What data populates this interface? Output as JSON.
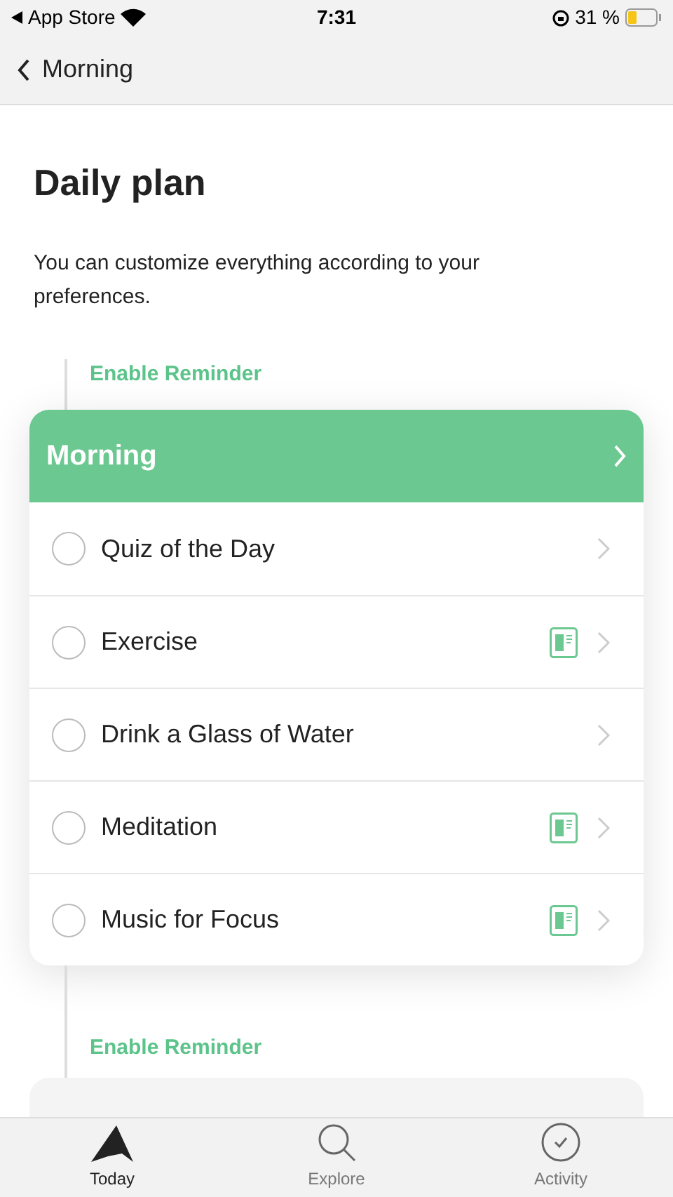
{
  "status_bar": {
    "back_label": "App Store",
    "time": "7:31",
    "battery": "31 %"
  },
  "nav": {
    "back": "Morning"
  },
  "title": "Daily plan",
  "description": "You can customize everything according to your preferences.",
  "sections": [
    {
      "reminder": "Enable Reminder",
      "card": {
        "title": "Morning",
        "items": [
          {
            "label": "Quiz of the Day",
            "checked": false,
            "has_guide": false
          },
          {
            "label": "Exercise",
            "checked": false,
            "has_guide": true
          },
          {
            "label": "Drink a Glass of Water",
            "checked": false,
            "has_guide": false
          },
          {
            "label": "Meditation",
            "checked": false,
            "has_guide": true
          },
          {
            "label": "Music for Focus",
            "checked": false,
            "has_guide": true
          }
        ]
      }
    },
    {
      "reminder": "Enable Reminder"
    }
  ],
  "tab_bar": [
    {
      "label": "Today",
      "kind": "today",
      "selected": true
    },
    {
      "label": "Explore",
      "kind": "explore",
      "selected": false
    },
    {
      "label": "Activity",
      "kind": "activity",
      "selected": false
    }
  ]
}
